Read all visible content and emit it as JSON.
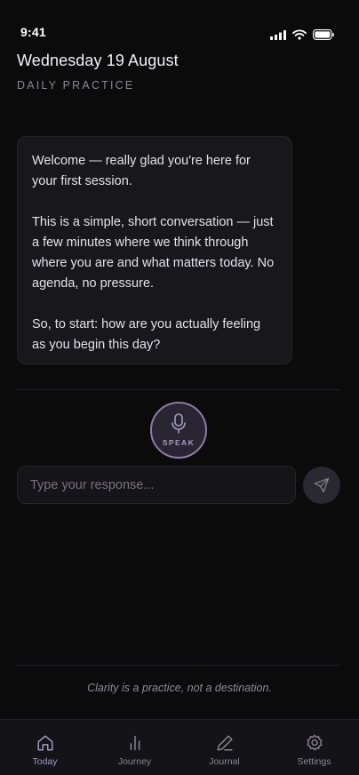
{
  "status_bar": {
    "time": "9:41",
    "icons": [
      "signal-icon",
      "wifi-icon",
      "battery-icon"
    ]
  },
  "header": {
    "date": "Wednesday 19 August",
    "subtitle": "DAILY PRACTICE"
  },
  "message": {
    "paragraphs": [
      "Welcome — really glad you're here for your first session.",
      "This is a simple, short conversation — just a few minutes where we think through where you are and what matters today. No agenda, no pressure.",
      "So, to start: how are you actually feeling as you begin this day?"
    ]
  },
  "speak": {
    "label": "SPEAK",
    "icon": "microphone-icon"
  },
  "input": {
    "placeholder": "Type your response...",
    "value": ""
  },
  "send": {
    "icon": "send-icon"
  },
  "footer": {
    "quote": "Clarity is a practice, not a destination."
  },
  "tabs": [
    {
      "label": "Today",
      "icon": "home-icon",
      "active": true
    },
    {
      "label": "Journey",
      "icon": "bar-chart-icon",
      "active": false
    },
    {
      "label": "Journal",
      "icon": "pen-icon",
      "active": false
    },
    {
      "label": "Settings",
      "icon": "gear-icon",
      "active": false
    }
  ],
  "colors": {
    "accent": "#a898c4",
    "background": "#0b0b0c",
    "bubble": "#18171b"
  }
}
